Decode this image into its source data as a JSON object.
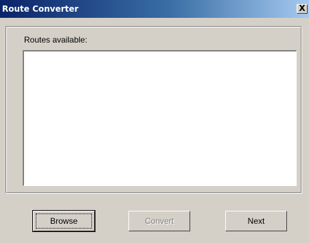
{
  "window": {
    "title": "Route Converter",
    "close_glyph": "X"
  },
  "routes": {
    "label": "Routes available:",
    "items": []
  },
  "buttons": {
    "browse": "Browse",
    "convert": "Convert",
    "next": "Next"
  },
  "colors": {
    "titlebar_start": "#0a246a",
    "titlebar_end": "#a6caf0",
    "face": "#d4d0c8",
    "disabled_text": "#808080"
  }
}
